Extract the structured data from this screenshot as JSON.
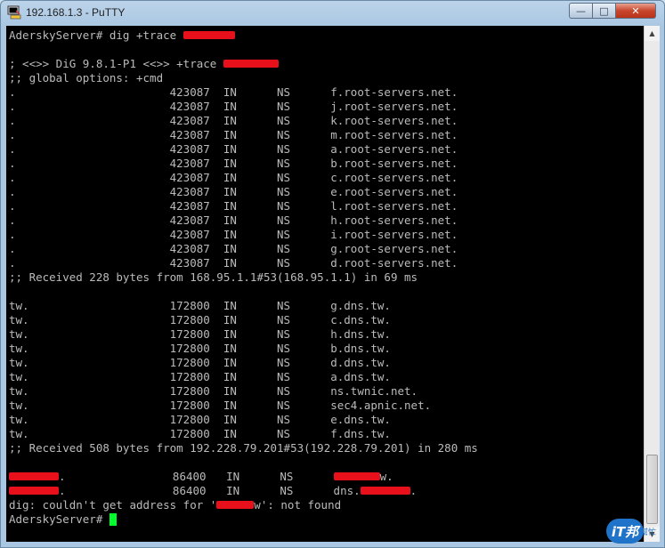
{
  "window": {
    "title": "192.168.1.3 - PuTTY",
    "controls": {
      "minimize": "—",
      "maximize": "□",
      "close": "✕"
    }
  },
  "terminal": {
    "foreground": "#bbbbbb",
    "background": "#000000",
    "cursor_color": "#00ff2a",
    "redaction_color": "#e8101a",
    "lines": [
      {
        "segments": [
          {
            "t": "AderskyServer# dig +trace "
          },
          {
            "redact": true,
            "w": 58
          }
        ]
      },
      {
        "segments": []
      },
      {
        "segments": [
          {
            "t": "; <<>> DiG 9.8.1-P1 <<>> +trace "
          },
          {
            "redact": true,
            "w": 62
          }
        ]
      },
      {
        "segments": [
          {
            "t": ";; global options: +cmd"
          }
        ]
      },
      {
        "segments": [
          {
            "t": ".                       423087  IN      NS      f.root-servers.net."
          }
        ]
      },
      {
        "segments": [
          {
            "t": ".                       423087  IN      NS      j.root-servers.net."
          }
        ]
      },
      {
        "segments": [
          {
            "t": ".                       423087  IN      NS      k.root-servers.net."
          }
        ]
      },
      {
        "segments": [
          {
            "t": ".                       423087  IN      NS      m.root-servers.net."
          }
        ]
      },
      {
        "segments": [
          {
            "t": ".                       423087  IN      NS      a.root-servers.net."
          }
        ]
      },
      {
        "segments": [
          {
            "t": ".                       423087  IN      NS      b.root-servers.net."
          }
        ]
      },
      {
        "segments": [
          {
            "t": ".                       423087  IN      NS      c.root-servers.net."
          }
        ]
      },
      {
        "segments": [
          {
            "t": ".                       423087  IN      NS      e.root-servers.net."
          }
        ]
      },
      {
        "segments": [
          {
            "t": ".                       423087  IN      NS      l.root-servers.net."
          }
        ]
      },
      {
        "segments": [
          {
            "t": ".                       423087  IN      NS      h.root-servers.net."
          }
        ]
      },
      {
        "segments": [
          {
            "t": ".                       423087  IN      NS      i.root-servers.net."
          }
        ]
      },
      {
        "segments": [
          {
            "t": ".                       423087  IN      NS      g.root-servers.net."
          }
        ]
      },
      {
        "segments": [
          {
            "t": ".                       423087  IN      NS      d.root-servers.net."
          }
        ]
      },
      {
        "segments": [
          {
            "t": ";; Received 228 bytes from 168.95.1.1#53(168.95.1.1) in 69 ms"
          }
        ]
      },
      {
        "segments": []
      },
      {
        "segments": [
          {
            "t": "tw.                     172800  IN      NS      g.dns.tw."
          }
        ]
      },
      {
        "segments": [
          {
            "t": "tw.                     172800  IN      NS      c.dns.tw."
          }
        ]
      },
      {
        "segments": [
          {
            "t": "tw.                     172800  IN      NS      h.dns.tw."
          }
        ]
      },
      {
        "segments": [
          {
            "t": "tw.                     172800  IN      NS      b.dns.tw."
          }
        ]
      },
      {
        "segments": [
          {
            "t": "tw.                     172800  IN      NS      d.dns.tw."
          }
        ]
      },
      {
        "segments": [
          {
            "t": "tw.                     172800  IN      NS      a.dns.tw."
          }
        ]
      },
      {
        "segments": [
          {
            "t": "tw.                     172800  IN      NS      ns.twnic.net."
          }
        ]
      },
      {
        "segments": [
          {
            "t": "tw.                     172800  IN      NS      sec4.apnic.net."
          }
        ]
      },
      {
        "segments": [
          {
            "t": "tw.                     172800  IN      NS      e.dns.tw."
          }
        ]
      },
      {
        "segments": [
          {
            "t": "tw.                     172800  IN      NS      f.dns.tw."
          }
        ]
      },
      {
        "segments": [
          {
            "t": ";; Received 508 bytes from 192.228.79.201#53(192.228.79.201) in 280 ms"
          }
        ]
      },
      {
        "segments": []
      },
      {
        "segments": [
          {
            "redact": true,
            "w": 56
          },
          {
            "t": ".                86400   IN      NS      "
          },
          {
            "redact": true,
            "w": 52
          },
          {
            "t": "w."
          }
        ]
      },
      {
        "segments": [
          {
            "redact": true,
            "w": 56
          },
          {
            "t": ".                86400   IN      NS      dns."
          },
          {
            "redact": true,
            "w": 56
          },
          {
            "t": "."
          }
        ]
      },
      {
        "segments": [
          {
            "t": "dig: couldn't get address for '"
          },
          {
            "redact": true,
            "w": 42
          },
          {
            "t": "w': not found"
          }
        ]
      },
      {
        "segments": [
          {
            "t": "AderskyServer# "
          },
          {
            "cursor": true
          }
        ]
      }
    ]
  },
  "watermark": {
    "logo_text": "iT邦",
    "sub_text": "幫忙"
  }
}
